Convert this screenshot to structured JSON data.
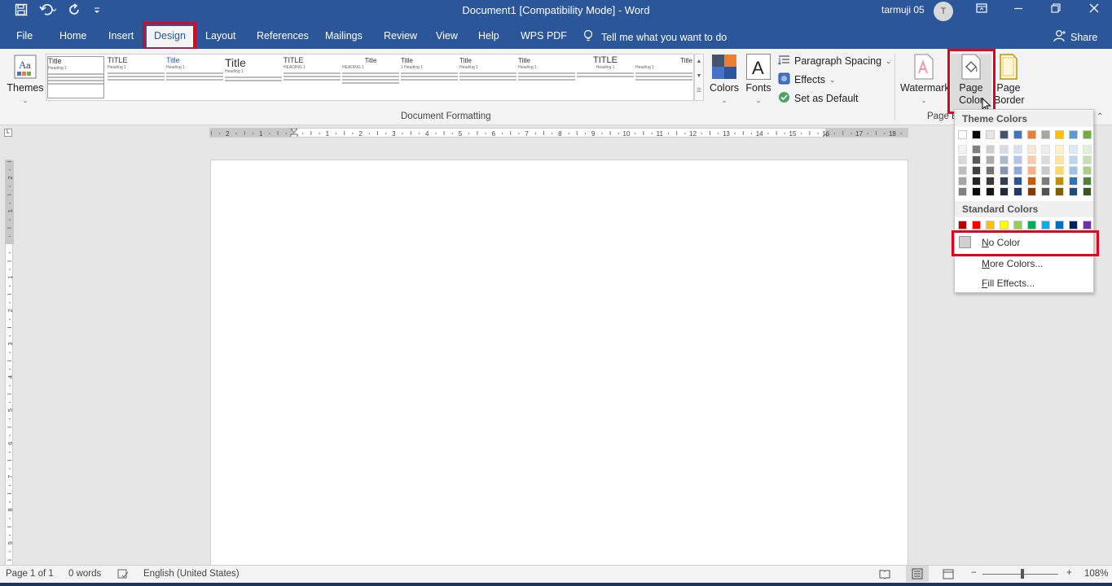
{
  "titlebar": {
    "title": "Document1 [Compatibility Mode]  -  Word",
    "user_name": "tarmuji 05",
    "avatar_initial": "T",
    "qat_icons": [
      "save-icon",
      "undo-icon",
      "redo-icon",
      "customize-icon"
    ]
  },
  "tabs": [
    "File",
    "Home",
    "Insert",
    "Design",
    "Layout",
    "References",
    "Mailings",
    "Review",
    "View",
    "Help",
    "WPS PDF"
  ],
  "active_tab": "Design",
  "tell_me": "Tell me what you want to do",
  "share": "Share",
  "ribbon": {
    "themes_label": "Themes",
    "styles_gallery": [
      {
        "title": "Title",
        "heading": "Heading 1"
      },
      {
        "title": "TITLE",
        "heading": "Heading 1"
      },
      {
        "title": "Title",
        "heading": "Heading 1"
      },
      {
        "title": "Title",
        "heading": "Heading 1"
      },
      {
        "title": "TITLE",
        "heading": "HEADING 1"
      },
      {
        "title": "Title",
        "heading": "HEADING 1"
      },
      {
        "title": "Title",
        "heading": "1  Heading 1"
      },
      {
        "title": "Title",
        "heading": "Heading 1"
      },
      {
        "title": "Title",
        "heading": "Heading 1"
      },
      {
        "title": "TITLE",
        "heading": "Heading 1"
      },
      {
        "title": "Title",
        "heading": "Heading 1"
      }
    ],
    "document_formatting_label": "Document Formatting",
    "colors_label": "Colors",
    "fonts_label": "Fonts",
    "paragraph_spacing_label": "Paragraph Spacing",
    "effects_label": "Effects",
    "set_default_label": "Set as Default",
    "watermark_label": "Watermark",
    "page_color_label_1": "Page",
    "page_color_label_2": "Color",
    "page_borders_label_1": "Page",
    "page_borders_label_2": "Borders",
    "page_background_group_label": "Page B"
  },
  "ruler_numbers": [
    "2",
    "1",
    "1",
    "2",
    "3",
    "4",
    "5",
    "6",
    "7",
    "8",
    "9",
    "10",
    "11",
    "12",
    "13",
    "14",
    "15",
    "16",
    "17",
    "18"
  ],
  "vruler_numbers": [
    "2",
    "1",
    "1",
    "2",
    "3",
    "4",
    "5",
    "6",
    "7",
    "8",
    "9"
  ],
  "page_color_menu": {
    "theme_colors_label": "Theme Colors",
    "theme_top_row": [
      "#ffffff",
      "#000000",
      "#e7e6e6",
      "#44546a",
      "#4472c4",
      "#ed7d31",
      "#a5a5a5",
      "#ffc000",
      "#5b9bd5",
      "#70ad47"
    ],
    "theme_shades": [
      [
        "#f2f2f2",
        "#d9d9d9",
        "#bfbfbf",
        "#a6a6a6",
        "#808080"
      ],
      [
        "#808080",
        "#595959",
        "#404040",
        "#262626",
        "#0d0d0d"
      ],
      [
        "#d0cece",
        "#aeabab",
        "#757171",
        "#3a3838",
        "#171616"
      ],
      [
        "#d6dce4",
        "#adb9ca",
        "#8496b0",
        "#333f4f",
        "#222a35"
      ],
      [
        "#d9e2f3",
        "#b4c6e7",
        "#8eaadb",
        "#2f5496",
        "#1f3864"
      ],
      [
        "#fbe5d5",
        "#f7cbac",
        "#f4b183",
        "#c55a11",
        "#833c0b"
      ],
      [
        "#ededed",
        "#dbdbdb",
        "#c9c9c9",
        "#7b7b7b",
        "#525252"
      ],
      [
        "#fff2cc",
        "#fee599",
        "#ffd965",
        "#bf9000",
        "#7f6000"
      ],
      [
        "#deebf6",
        "#bdd7ee",
        "#9cc3e5",
        "#2e75b5",
        "#1e4e79"
      ],
      [
        "#e2efd9",
        "#c5e0b3",
        "#a8d08d",
        "#538135",
        "#375623"
      ]
    ],
    "standard_colors_label": "Standard Colors",
    "standard_colors": [
      "#c00000",
      "#ff0000",
      "#ffc000",
      "#ffff00",
      "#92d050",
      "#00b050",
      "#00b0f0",
      "#0070c0",
      "#002060",
      "#7030a0"
    ],
    "no_color_prefix": "N",
    "no_color_rest": "o Color",
    "more_colors_prefix": "M",
    "more_colors_rest": "ore Colors...",
    "fill_effects_prefix": "F",
    "fill_effects_rest": "ill Effects..."
  },
  "statusbar": {
    "page": "Page 1 of 1",
    "words": "0 words",
    "language": "English (United States)",
    "zoom": "108%"
  },
  "colors": {
    "accent": "#2b579a",
    "highlight": "#e00020"
  }
}
